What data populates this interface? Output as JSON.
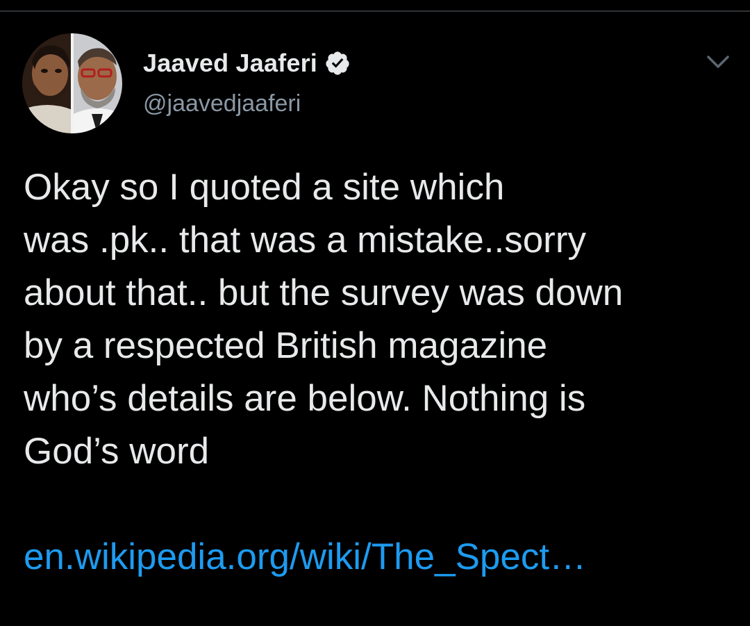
{
  "author": {
    "display_name": "Jaaved Jaaferi",
    "handle": "@jaavedjaaferi",
    "verified": true
  },
  "tweet": {
    "text_lines": [
      "Okay so I quoted a site which",
      "was .pk.. that was a mistake..sorry",
      "about that.. but the survey was down",
      "by a respected British magazine",
      "who’s details are below. Nothing is",
      "God’s word"
    ],
    "link": "en.wikipedia.org/wiki/The_Spect…"
  },
  "icons": {
    "verified": "verified-badge-icon",
    "menu": "chevron-down-icon"
  },
  "colors": {
    "background": "#000000",
    "text": "#e7e9ea",
    "secondary_text": "#8b98a5",
    "link": "#1d9bf0",
    "divider": "#2f3336"
  }
}
